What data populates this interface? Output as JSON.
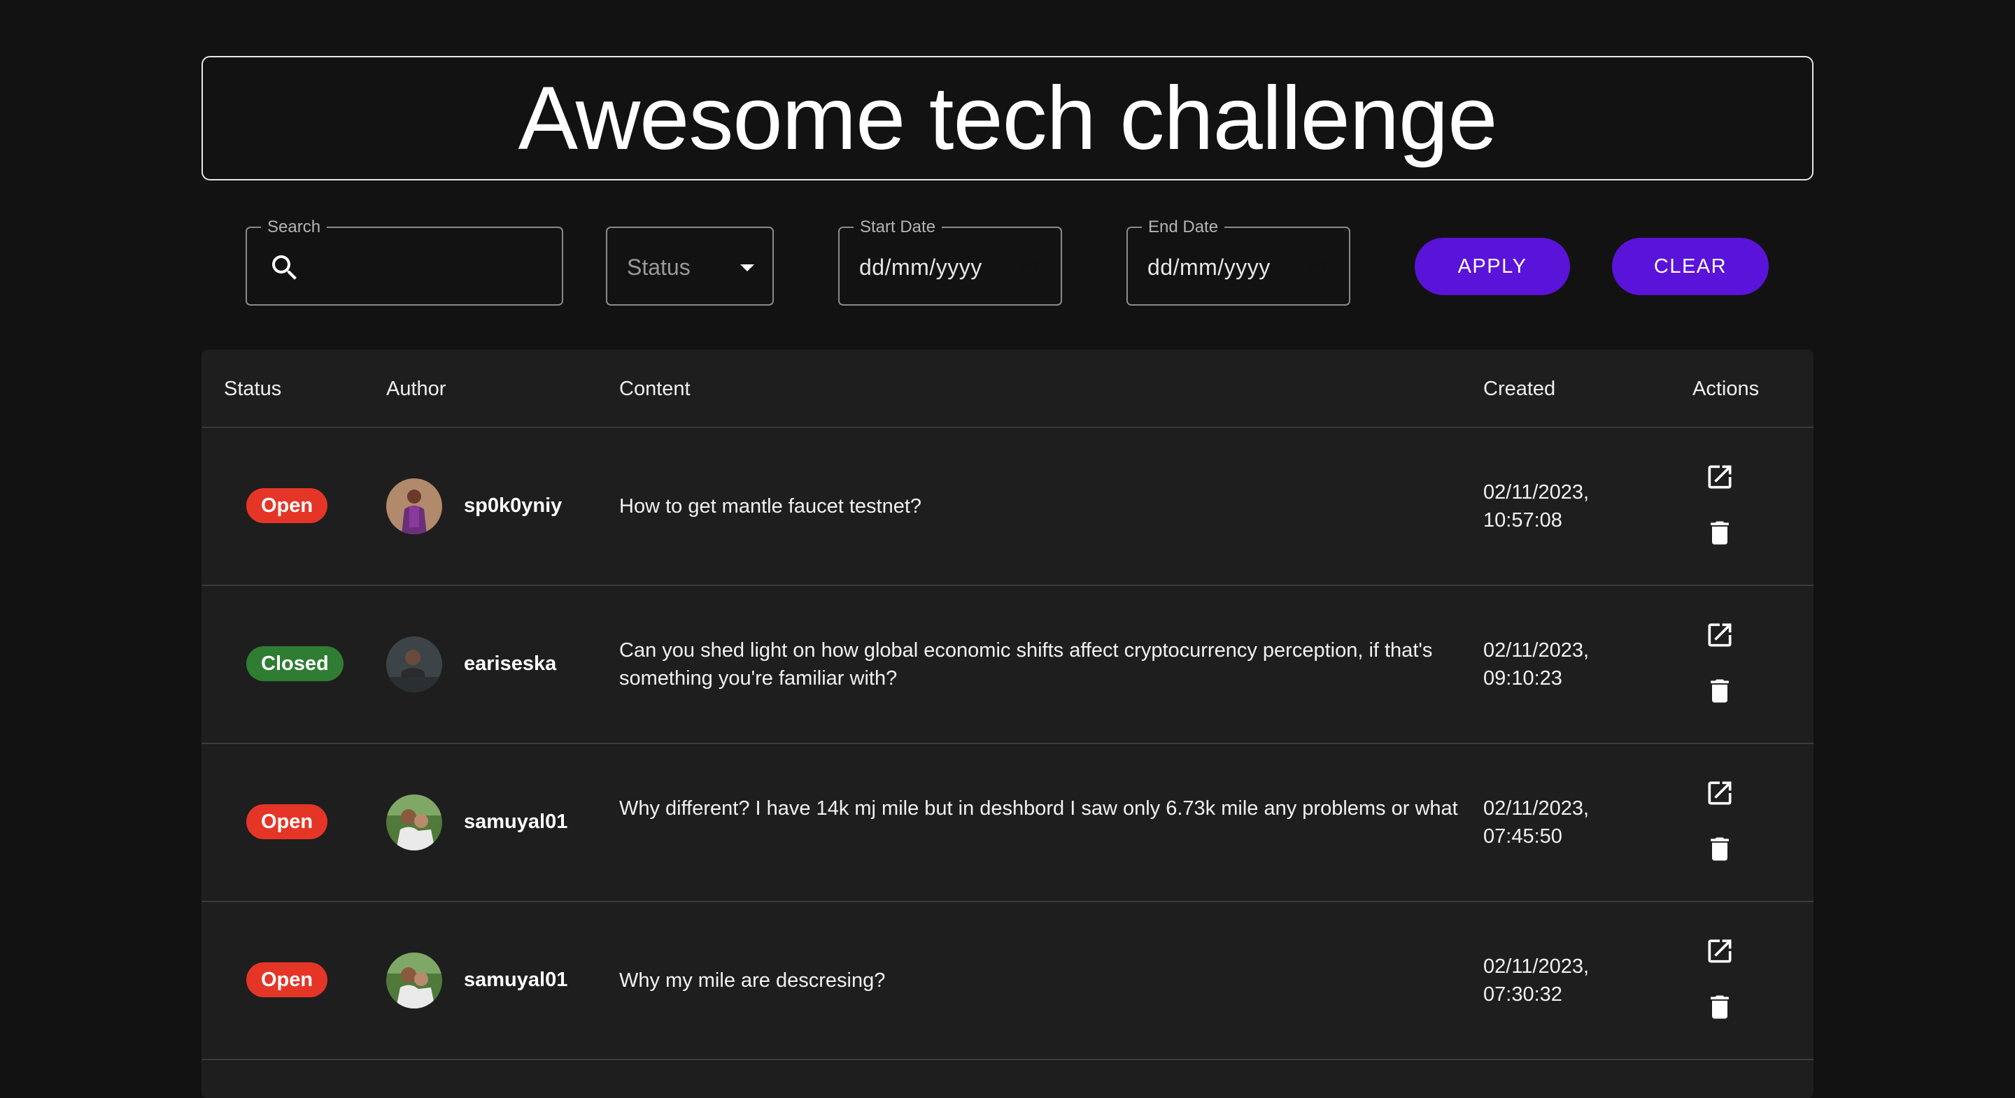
{
  "header": {
    "title": "Awesome tech challenge"
  },
  "filters": {
    "search_label": "Search",
    "search_value": "",
    "status_placeholder": "Status",
    "start_date_label": "Start Date",
    "start_date_value": "dd/mm/yyyy",
    "end_date_label": "End Date",
    "end_date_value": "dd/mm/yyyy",
    "apply_label": "APPLY",
    "clear_label": "CLEAR"
  },
  "table": {
    "columns": [
      "Status",
      "Author",
      "Content",
      "Created",
      "Actions"
    ],
    "rows": [
      {
        "status": "Open",
        "author": "sp0k0yniy",
        "content": "How to get mantle faucet testnet?",
        "created_date": "02/11/2023,",
        "created_time": "10:57:08"
      },
      {
        "status": "Closed",
        "author": "eariseska",
        "content": "Can you shed light on how global economic shifts affect cryptocurrency perception, if that's something you're familiar with?",
        "created_date": "02/11/2023,",
        "created_time": "09:10:23"
      },
      {
        "status": "Open",
        "author": "samuyal01",
        "content": "Why different? I have 14k mj mile but in deshbord I saw only 6.73k mile any problems or what",
        "created_date": "02/11/2023,",
        "created_time": "07:45:50"
      },
      {
        "status": "Open",
        "author": "samuyal01",
        "content": "Why my mile are descresing?",
        "created_date": "02/11/2023,",
        "created_time": "07:30:32"
      }
    ]
  },
  "colors": {
    "background": "#121212",
    "table_bg": "#1e1e1e",
    "accent": "#5a13d9",
    "open": "#e53527",
    "closed": "#2e7d32"
  },
  "icons": {
    "search": "search-icon",
    "status_dropdown": "caret-down-icon",
    "date": "calendar-icon",
    "open_action": "open-in-new-icon",
    "delete_action": "trash-icon"
  }
}
